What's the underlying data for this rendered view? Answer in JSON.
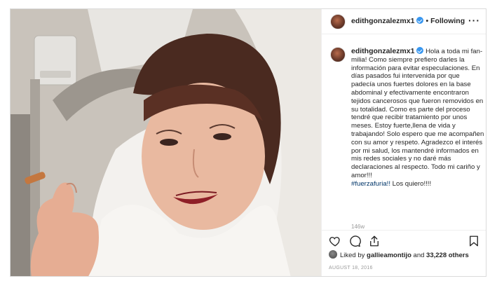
{
  "post": {
    "username": "edithgonzalezmx1",
    "separator": "•",
    "follow_state": "Following",
    "more_label": "···",
    "caption_username": "edithgonzalezmx1",
    "caption_text": "Hola a toda mi fan-milia! Como siempre prefiero darles la información para evitar especulaciones. En días pasados fui intervenida por que padecía unos fuertes dolores en la base abdominal y efectivamente encontraron tejidos cancerosos que fueron removidos en su totalidad. Como es parte del proceso tendré que recibir tratamiento por unos meses. Estoy fuerte,llena de vida y trabajando! Solo espero que me acompañen con su amor y respeto. Agradezco el interés por mi salud, los mantendré informados en mis redes sociales y no daré más declaraciones al respecto. Todo mi cariño y amor!!!",
    "hashtag": "#fuerzafuria!!",
    "caption_end": " Los quiero!!!!",
    "time_ago": "146w",
    "likes_prefix": "Liked by ",
    "liked_by_user": "gallieamontijo",
    "likes_middle": " and ",
    "likes_count": "33,228 others",
    "date": "AUGUST 18, 2016"
  },
  "icons": {
    "verified": "verified-badge-icon",
    "like": "heart-icon",
    "comment": "comment-icon",
    "share": "share-icon",
    "save": "bookmark-icon",
    "more": "more-options-icon"
  },
  "colors": {
    "verified_blue": "#3897f0",
    "hashtag": "#003569",
    "muted": "#999999",
    "border": "#dbdbdb"
  }
}
